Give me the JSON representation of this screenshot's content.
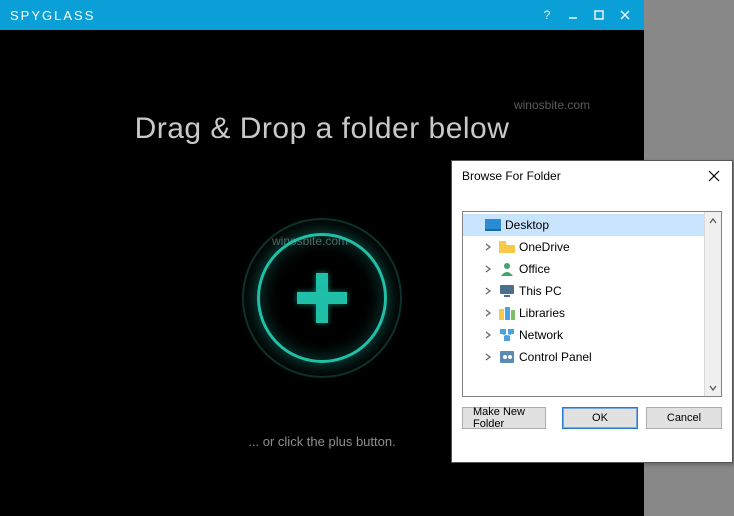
{
  "app": {
    "title": "SPYGLASS",
    "heading": "Drag & Drop a folder below",
    "hint": "... or click the plus button.",
    "watermark": "winosbite.com"
  },
  "dialog": {
    "title": "Browse For Folder",
    "buttons": {
      "new_folder": "Make New Folder",
      "ok": "OK",
      "cancel": "Cancel"
    },
    "tree": [
      {
        "label": "Desktop",
        "icon": "desktop",
        "selected": true,
        "child": false,
        "expandable": false
      },
      {
        "label": "OneDrive",
        "icon": "folder",
        "selected": false,
        "child": true,
        "expandable": true
      },
      {
        "label": "Office",
        "icon": "user",
        "selected": false,
        "child": true,
        "expandable": true
      },
      {
        "label": "This PC",
        "icon": "pc",
        "selected": false,
        "child": true,
        "expandable": true
      },
      {
        "label": "Libraries",
        "icon": "libraries",
        "selected": false,
        "child": true,
        "expandable": true
      },
      {
        "label": "Network",
        "icon": "network",
        "selected": false,
        "child": true,
        "expandable": true
      },
      {
        "label": "Control Panel",
        "icon": "control",
        "selected": false,
        "child": true,
        "expandable": true
      }
    ]
  }
}
